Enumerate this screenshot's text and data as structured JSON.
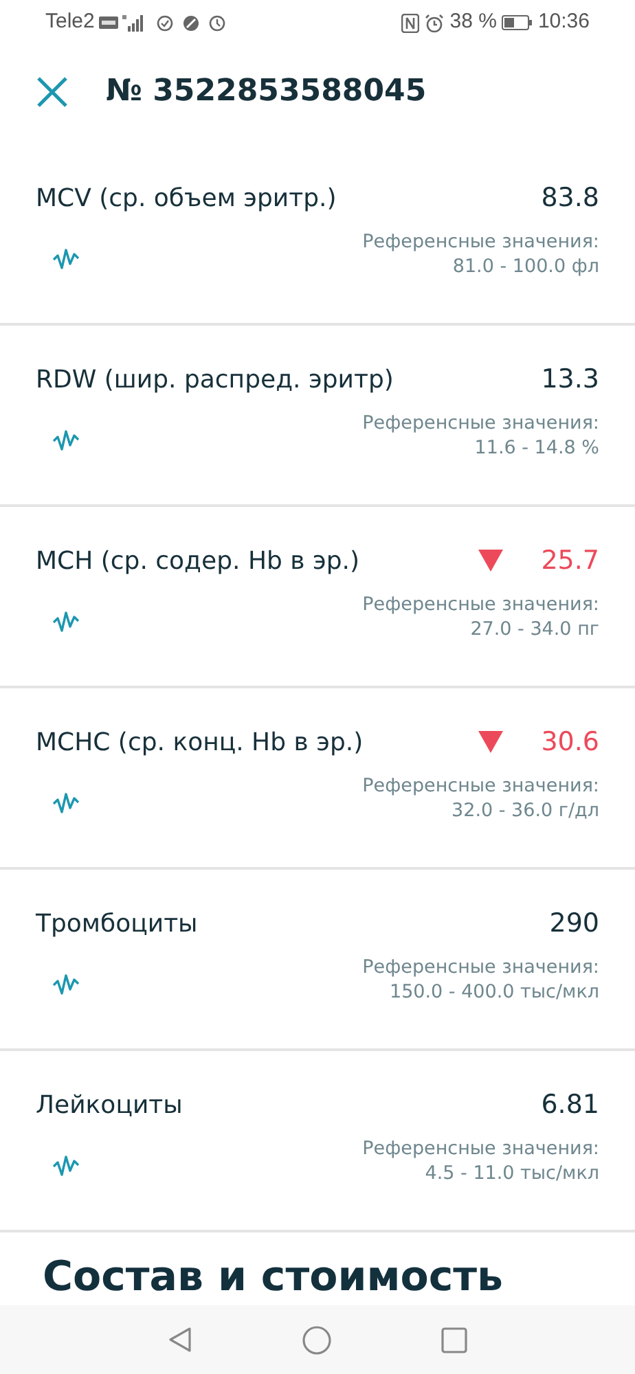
{
  "status_bar": {
    "carrier": "Tele2",
    "battery_percent": "38 %",
    "time": "10:36"
  },
  "header": {
    "title": "№ 3522853588045"
  },
  "results": [
    {
      "name": "MCV (ср. объем эритр.)",
      "value": "83.8",
      "below_range": false,
      "reference_label": "Референсные значения:",
      "reference_range": "81.0 - 100.0 фл"
    },
    {
      "name": "RDW (шир. распред. эритр)",
      "value": "13.3",
      "below_range": false,
      "reference_label": "Референсные значения:",
      "reference_range": "11.6 - 14.8 %"
    },
    {
      "name": "MCH (ср. содер. Hb в эр.)",
      "value": "25.7",
      "below_range": true,
      "reference_label": "Референсные значения:",
      "reference_range": "27.0 - 34.0 пг"
    },
    {
      "name": "MCHC (ср. конц. Hb в эр.)",
      "value": "30.6",
      "below_range": true,
      "reference_label": "Референсные значения:",
      "reference_range": "32.0 - 36.0 г/дл"
    },
    {
      "name": "Тромбоциты",
      "value": "290",
      "below_range": false,
      "reference_label": "Референсные значения:",
      "reference_range": "150.0 - 400.0 тыс/мкл"
    },
    {
      "name": "Лейкоциты",
      "value": "6.81",
      "below_range": false,
      "reference_label": "Референсные значения:",
      "reference_range": "4.5 - 11.0 тыс/мкл"
    }
  ],
  "section_heading": "Состав и стоимость"
}
